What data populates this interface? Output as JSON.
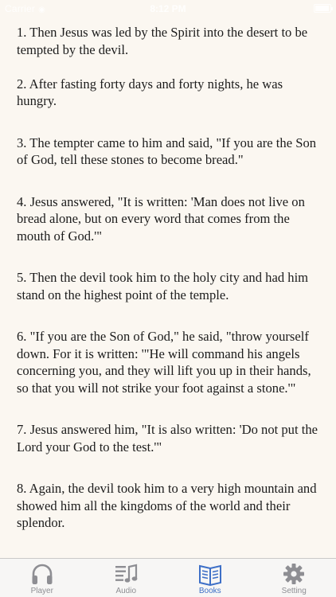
{
  "status_bar": {
    "carrier": "Carrier",
    "time": "8:12 PM"
  },
  "verses": [
    {
      "text": "1. Then Jesus was led by the Spirit into the desert to be tempted by the devil."
    },
    {
      "text": "2. After fasting forty days and forty nights, he was hungry."
    },
    {
      "text": "3. The tempter came to him and said, \"If you are the Son of God, tell these stones to become bread.\""
    },
    {
      "text": "4. Jesus answered, \"It is written: 'Man does not live on bread alone, but on every word that comes from the mouth of God.'\""
    },
    {
      "text": "5. Then the devil took him to the holy city and had him stand on the highest point of the temple."
    },
    {
      "text": "6. \"If you are the Son of God,\" he said, \"throw yourself down. For it is written: '\"He will command his angels concerning you, and they will lift you up in their hands, so that you will not strike your foot against a stone.'\""
    },
    {
      "text": "7. Jesus answered him, \"It is also written: 'Do not put the Lord your God to the test.'\""
    },
    {
      "text": "8. Again, the devil took him to a very high mountain and showed him all the kingdoms of the world and their splendor."
    }
  ],
  "tabs": [
    {
      "label": "Player",
      "icon": "headphones-icon"
    },
    {
      "label": "Audio",
      "icon": "music-list-icon"
    },
    {
      "label": "Books",
      "icon": "book-icon"
    },
    {
      "label": "Setting",
      "icon": "gear-icon"
    }
  ],
  "colors": {
    "background": "#fbf7f1",
    "text": "#1c1c1c",
    "tab_active": "#3d6fc7",
    "tab_inactive": "#8e8e93"
  }
}
